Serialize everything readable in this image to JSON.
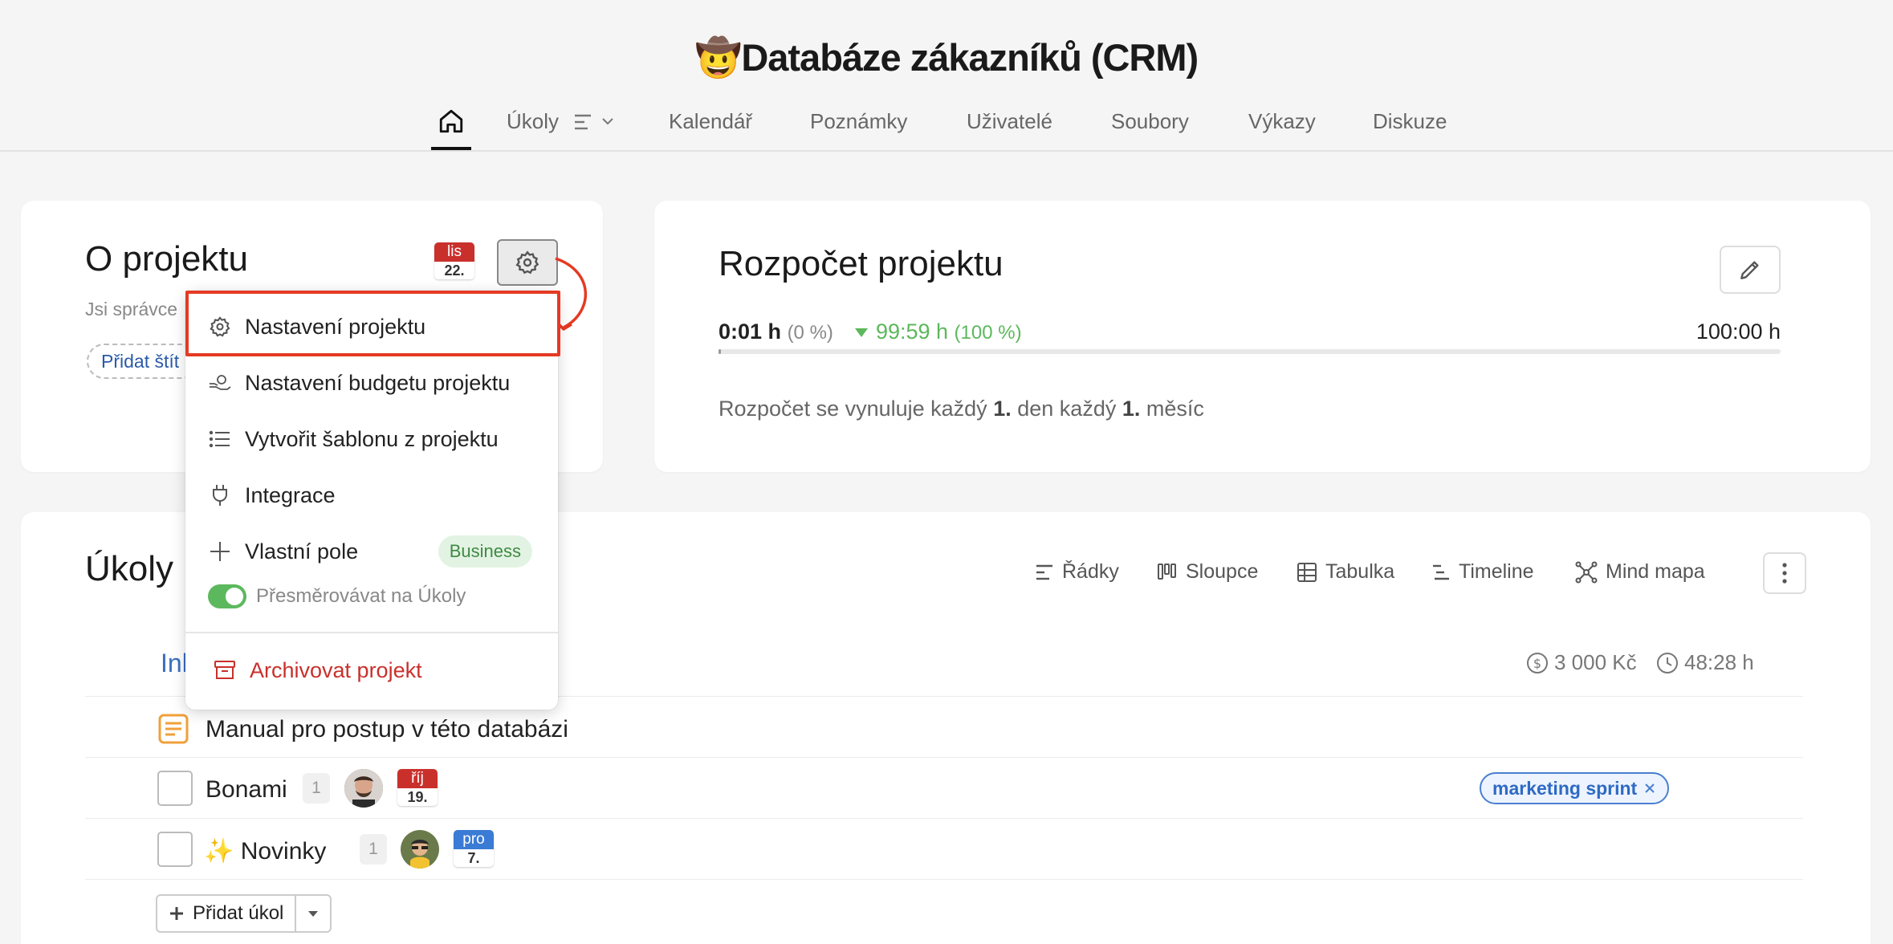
{
  "header": {
    "emoji": "🤠",
    "title": "Databáze zákazníků (CRM)",
    "nav": [
      "Úkoly",
      "Kalendář",
      "Poznámky",
      "Uživatelé",
      "Soubory",
      "Výkazy",
      "Diskuze"
    ]
  },
  "about": {
    "title": "O projektu",
    "subtitle": "Jsi správce",
    "add_tag": "Přidat štít",
    "date": {
      "month": "lis",
      "day": "22."
    }
  },
  "menu": {
    "items": [
      {
        "label": "Nastavení projektu",
        "icon": "gear-icon"
      },
      {
        "label": "Nastavení budgetu projektu",
        "icon": "money-hand-icon"
      },
      {
        "label": "Vytvořit šablonu z projektu",
        "icon": "list-icon"
      },
      {
        "label": "Integrace",
        "icon": "plug-icon"
      },
      {
        "label": "Vlastní pole",
        "icon": "plus-icon",
        "badge": "Business"
      }
    ],
    "toggle_label": "Přesměrovávat na Úkoly",
    "toggle_on": true,
    "archive_label": "Archivovat projekt"
  },
  "budget": {
    "title": "Rozpočet projektu",
    "spent": "0:01 h",
    "spent_pct": "(0 %)",
    "remaining": "99:59 h",
    "remaining_pct": "(100 %)",
    "total": "100:00 h",
    "note_prefix": "Rozpočet se vynuluje každý",
    "note_day": "1.",
    "note_mid": "den každý",
    "note_month": "1.",
    "note_suffix": "měsíc",
    "colors": {
      "remaining": "#5cb85c"
    }
  },
  "tasks": {
    "title": "Úkoly",
    "views": [
      "Řádky",
      "Sloupce",
      "Tabulka",
      "Timeline",
      "Mind mapa"
    ],
    "group_label": "Inl",
    "sum_money": "3 000 Kč",
    "sum_time": "48:28 h",
    "rows": [
      {
        "name": "Manual pro postup v této databázi"
      },
      {
        "name": "Bonami",
        "count": "1",
        "month": "říj",
        "day": "19.",
        "tag": "marketing sprint"
      },
      {
        "name": "Novinky",
        "emoji": "✨",
        "count": "1",
        "month": "pro",
        "day": "7."
      }
    ],
    "add_label": "Přidat úkol"
  }
}
